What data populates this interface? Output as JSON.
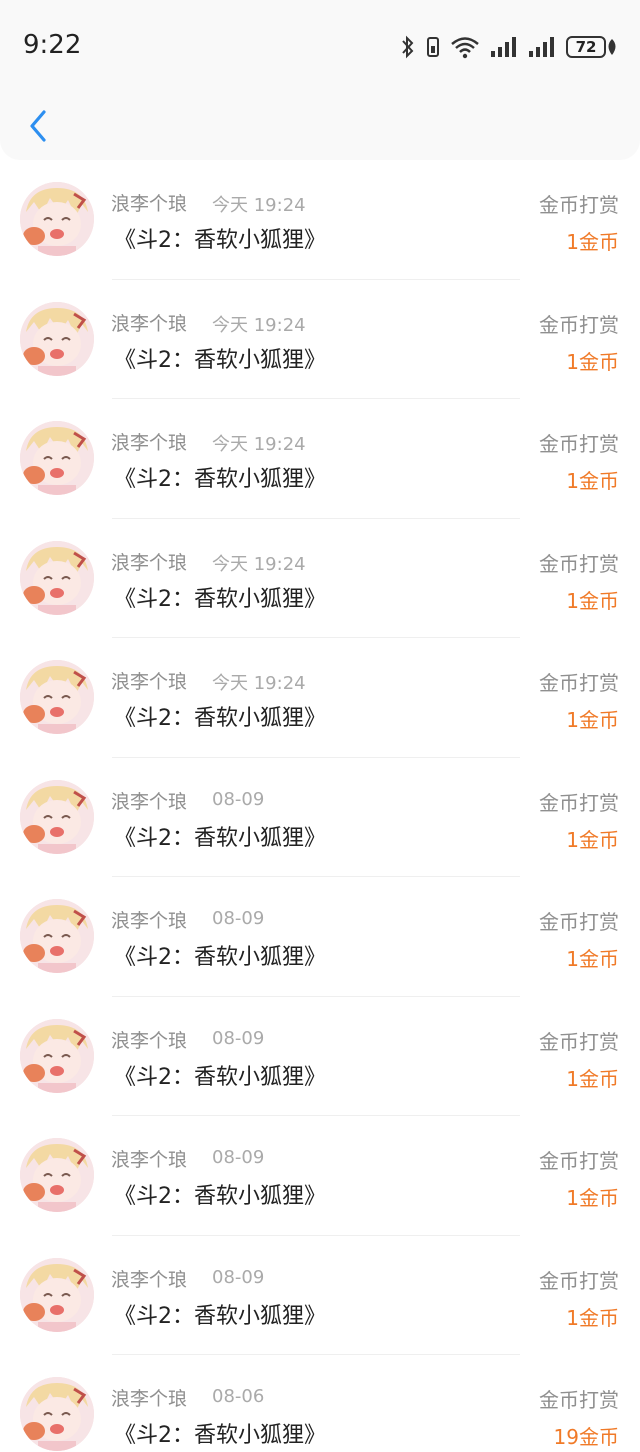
{
  "status_bar": {
    "time": "9:22",
    "battery": "72",
    "icons": [
      "bluetooth-icon",
      "vibrate-icon",
      "wifi-icon",
      "signal-icon",
      "signal-icon",
      "battery-icon",
      "leaf-icon"
    ]
  },
  "nav": {
    "back_icon": "chevron-left-icon",
    "accent": "#2d8ff0"
  },
  "colors": {
    "amount": "#f07a28",
    "muted": "#8f8f8f"
  },
  "records": [
    {
      "name": "浪李个琅",
      "time": "今天 19:24",
      "title": "《斗2：香软小狐狸》",
      "type": "金币打赏",
      "amount": "1金币"
    },
    {
      "name": "浪李个琅",
      "time": "今天 19:24",
      "title": "《斗2：香软小狐狸》",
      "type": "金币打赏",
      "amount": "1金币"
    },
    {
      "name": "浪李个琅",
      "time": "今天 19:24",
      "title": "《斗2：香软小狐狸》",
      "type": "金币打赏",
      "amount": "1金币"
    },
    {
      "name": "浪李个琅",
      "time": "今天 19:24",
      "title": "《斗2：香软小狐狸》",
      "type": "金币打赏",
      "amount": "1金币"
    },
    {
      "name": "浪李个琅",
      "time": "今天 19:24",
      "title": "《斗2：香软小狐狸》",
      "type": "金币打赏",
      "amount": "1金币"
    },
    {
      "name": "浪李个琅",
      "time": "08-09",
      "title": "《斗2：香软小狐狸》",
      "type": "金币打赏",
      "amount": "1金币"
    },
    {
      "name": "浪李个琅",
      "time": "08-09",
      "title": "《斗2：香软小狐狸》",
      "type": "金币打赏",
      "amount": "1金币"
    },
    {
      "name": "浪李个琅",
      "time": "08-09",
      "title": "《斗2：香软小狐狸》",
      "type": "金币打赏",
      "amount": "1金币"
    },
    {
      "name": "浪李个琅",
      "time": "08-09",
      "title": "《斗2：香软小狐狸》",
      "type": "金币打赏",
      "amount": "1金币"
    },
    {
      "name": "浪李个琅",
      "time": "08-09",
      "title": "《斗2：香软小狐狸》",
      "type": "金币打赏",
      "amount": "1金币"
    },
    {
      "name": "浪李个琅",
      "time": "08-06",
      "title": "《斗2：香软小狐狸》",
      "type": "金币打赏",
      "amount": "19金币"
    }
  ]
}
